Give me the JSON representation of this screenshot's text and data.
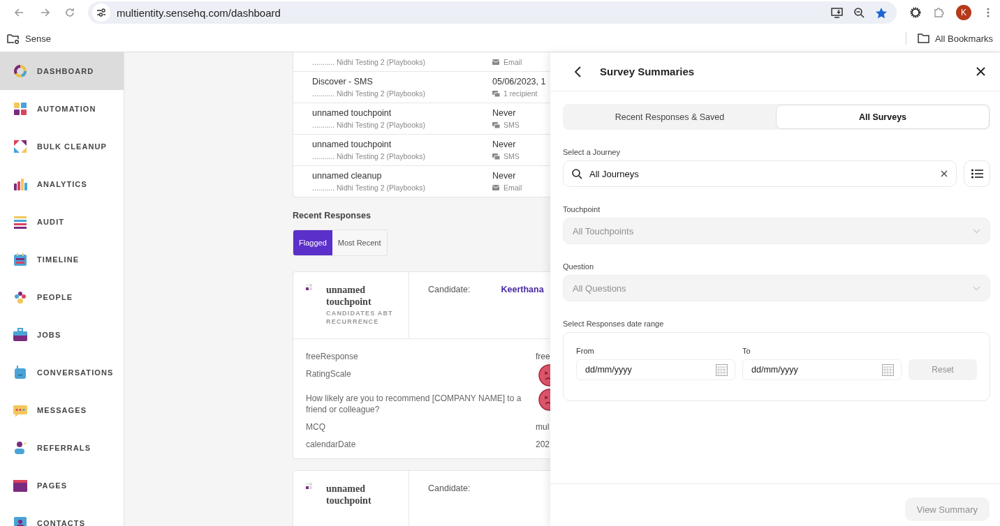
{
  "browser": {
    "url": "multientity.sensehq.com/dashboard",
    "bookmarked": true,
    "avatar": "K",
    "bookmarks": [
      {
        "label": "Sense"
      }
    ],
    "all_bookmarks": "All Bookmarks"
  },
  "sidebar": {
    "items": [
      {
        "label": "DASHBOARD",
        "selected": true
      },
      {
        "label": "AUTOMATION",
        "selected": false
      },
      {
        "label": "BULK CLEANUP",
        "selected": false
      },
      {
        "label": "ANALYTICS",
        "selected": false
      },
      {
        "label": "AUDIT",
        "selected": false
      },
      {
        "label": "TIMELINE",
        "selected": false
      },
      {
        "label": "PEOPLE",
        "selected": false
      },
      {
        "label": "JOBS",
        "selected": false
      },
      {
        "label": "CONVERSATIONS",
        "selected": false
      },
      {
        "label": "MESSAGES",
        "selected": false
      },
      {
        "label": "REFERRALS",
        "selected": false
      },
      {
        "label": "PAGES",
        "selected": false
      },
      {
        "label": "CONTACTS",
        "selected": false
      }
    ]
  },
  "touchpoints": [
    {
      "sub": "........... Nidhi Testing 2 (Playbooks)",
      "meta": "Email",
      "kind": "email"
    },
    {
      "title": "Discover - SMS",
      "sub": "........... Nidhi Testing 2 (Playbooks)",
      "date": "05/06/2023, 1",
      "meta": "1 recipient",
      "kind": "chat"
    },
    {
      "title": "unnamed touchpoint",
      "sub": "........... Nidhi Testing 2 (Playbooks)",
      "date": "Never",
      "meta": "SMS",
      "kind": "chat"
    },
    {
      "title": "unnamed touchpoint",
      "sub": "........... Nidhi Testing 2 (Playbooks)",
      "date": "Never",
      "meta": "SMS",
      "kind": "chat"
    },
    {
      "title": "unnamed cleanup",
      "sub": "........... Nidhi Testing 2 (Playbooks)",
      "date": "Never",
      "meta": "Email",
      "kind": "email"
    }
  ],
  "recent_responses": {
    "title": "Recent Responses",
    "filters": [
      {
        "label": "Flagged",
        "selected": true
      },
      {
        "label": "Most Recent",
        "selected": false
      }
    ]
  },
  "responses": [
    {
      "title": "unnamed touchpoint",
      "subtitle": "CANDIDATES ABT RECURRENCE",
      "candidate_label": "Candidate:",
      "candidate": "Keerthana",
      "answers": [
        {
          "question": "freeResponse",
          "kind": "text",
          "answer": "free"
        },
        {
          "question": "RatingScale",
          "kind": "face"
        },
        {
          "question": "How likely are you to recommend [COMPANY NAME] to a friend or colleague?",
          "kind": "face"
        },
        {
          "question": "MCQ",
          "kind": "text",
          "answer": "mul"
        },
        {
          "question": "calendarDate",
          "kind": "text",
          "answer": "202"
        }
      ]
    },
    {
      "title": "unnamed touchpoint",
      "candidate_label": "Candidate:"
    }
  ],
  "panel": {
    "title": "Survey Summaries",
    "tabs": [
      {
        "label": "Recent Responses & Saved",
        "selected": false
      },
      {
        "label": "All Surveys",
        "selected": true
      }
    ],
    "journey": {
      "label": "Select a Journey",
      "value": "All Journeys"
    },
    "touchpoint": {
      "label": "Touchpoint",
      "placeholder": "All Touchpoints",
      "disabled": true
    },
    "question": {
      "label": "Question",
      "placeholder": "All Questions",
      "disabled": true
    },
    "date_range": {
      "label": "Select Responses date range",
      "from_label": "From",
      "from_placeholder": "dd/mm/yyyy",
      "to_label": "To",
      "to_placeholder": "dd/mm/yyyy",
      "reset": "Reset",
      "reset_disabled": true
    },
    "submit": {
      "label": "View Summary",
      "disabled": true
    }
  }
}
